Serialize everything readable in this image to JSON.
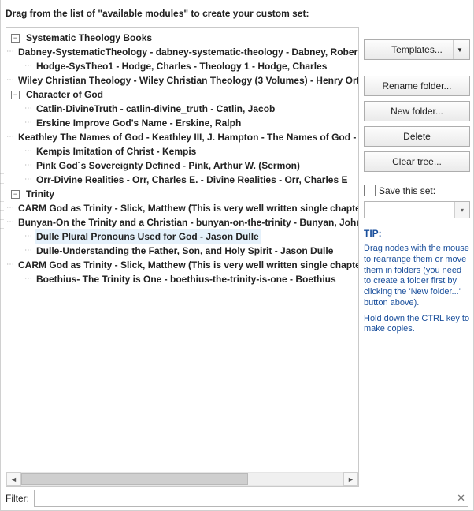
{
  "instruction": "Drag from the list of \"available modules\" to create your custom set:",
  "tree": [
    {
      "label": "Systematic Theology Books",
      "expanded": true,
      "children": [
        "Dabney-SystematicTheology - dabney-systematic-theology - Dabney, Robert Le",
        "Hodge-SysTheo1 - Hodge, Charles - Theology 1 - Hodge, Charles",
        "Wiley Christian Theology - Wiley Christian Theology (3 Volumes) - Henry Orton"
      ]
    },
    {
      "label": "Character of God",
      "expanded": true,
      "children": [
        "Catlin-DivineTruth - catlin-divine_truth - Catlin, Jacob",
        "Erskine Improve God's Name - Erskine, Ralph",
        "Keathley The Names of God - Keathley III, J. Hampton - The Names of God - Kea",
        "Kempis Imitation of Christ - Kempis",
        "Pink God´s Sovereignty Defined - Pink, Arthur W.  (Sermon)",
        "Orr-Divine Realities - Orr, Charles E. -  Divine Realities - Orr, Charles E"
      ]
    },
    {
      "label": "Trinity",
      "expanded": true,
      "children": [
        "CARM God as Trinity - Slick, Matthew (This is very well written single chapter on",
        "Bunyan-On the Trinity and a Christian - bunyan-on-the-trinity - Bunyan, John",
        "Dulle Plural Pronouns Used for God - Jason Dulle",
        "Dulle-Understanding the Father, Son, and Holy Spirit - Jason Dulle",
        "CARM God as Trinity - Slick, Matthew (This is very well written single chapter on",
        "Boethius- The Trinity is One - boethius-the-trinity-is-one - Boethius"
      ]
    }
  ],
  "selectedPath": "2.2",
  "buttons": {
    "templates": "Templates...",
    "rename": "Rename folder...",
    "newfolder": "New folder...",
    "delete": "Delete",
    "cleartree": "Clear tree..."
  },
  "saveThisSet": {
    "checkboxLabel": "Save this set:",
    "value": ""
  },
  "tip": {
    "head": "TIP:",
    "body1": "Drag nodes with the mouse to rearrange them or move them in folders (you need to create a folder first by clicking the 'New folder...' button above).",
    "body2": "Hold down the CTRL key to make copies."
  },
  "filter": {
    "label": "Filter:",
    "value": ""
  }
}
